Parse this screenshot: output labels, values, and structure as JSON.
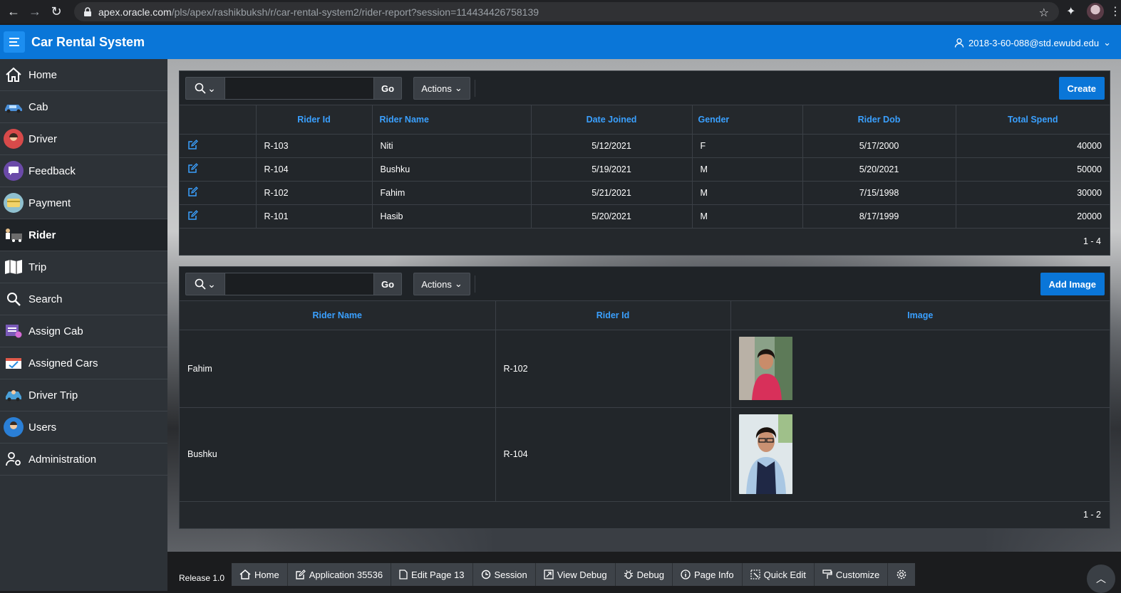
{
  "browser": {
    "url_host": "apex.oracle.com",
    "url_path": "/pls/apex/rashikbuksh/r/car-rental-system2/rider-report?session=114434426758139"
  },
  "header": {
    "title": "Car Rental System",
    "user": "2018-3-60-088@std.ewubd.edu"
  },
  "sidebar": {
    "items": [
      {
        "label": "Home",
        "icon": "home-icon"
      },
      {
        "label": "Cab",
        "icon": "cab-icon"
      },
      {
        "label": "Driver",
        "icon": "driver-icon"
      },
      {
        "label": "Feedback",
        "icon": "feedback-icon"
      },
      {
        "label": "Payment",
        "icon": "payment-icon"
      },
      {
        "label": "Rider",
        "icon": "rider-icon",
        "active": true
      },
      {
        "label": "Trip",
        "icon": "trip-icon"
      },
      {
        "label": "Search",
        "icon": "search-icon"
      },
      {
        "label": "Assign Cab",
        "icon": "assign-cab-icon"
      },
      {
        "label": "Assigned Cars",
        "icon": "assigned-cars-icon"
      },
      {
        "label": "Driver Trip",
        "icon": "driver-trip-icon"
      },
      {
        "label": "Users",
        "icon": "users-icon"
      },
      {
        "label": "Administration",
        "icon": "administration-icon"
      }
    ]
  },
  "riders_report": {
    "go_label": "Go",
    "actions_label": "Actions",
    "create_label": "Create",
    "columns": [
      "Rider Id",
      "Rider Name",
      "Date Joined",
      "Gender",
      "Rider Dob",
      "Total Spend"
    ],
    "rows": [
      {
        "rider_id": "R-103",
        "rider_name": "Niti",
        "date_joined": "5/12/2021",
        "gender": "F",
        "rider_dob": "5/17/2000",
        "total_spend": "40000"
      },
      {
        "rider_id": "R-104",
        "rider_name": "Bushku",
        "date_joined": "5/19/2021",
        "gender": "M",
        "rider_dob": "5/20/2021",
        "total_spend": "50000"
      },
      {
        "rider_id": "R-102",
        "rider_name": "Fahim",
        "date_joined": "5/21/2021",
        "gender": "M",
        "rider_dob": "7/15/1998",
        "total_spend": "30000"
      },
      {
        "rider_id": "R-101",
        "rider_name": "Hasib",
        "date_joined": "5/20/2021",
        "gender": "M",
        "rider_dob": "8/17/1999",
        "total_spend": "20000"
      }
    ],
    "pagination": "1 - 4"
  },
  "images_report": {
    "go_label": "Go",
    "actions_label": "Actions",
    "add_label": "Add Image",
    "columns": [
      "Rider Name",
      "Rider Id",
      "Image"
    ],
    "rows": [
      {
        "rider_name": "Fahim",
        "rider_id": "R-102"
      },
      {
        "rider_name": "Bushku",
        "rider_id": "R-104"
      }
    ],
    "pagination": "1 - 2"
  },
  "dev_toolbar": {
    "release": "Release 1.0",
    "items": [
      "Home",
      "Application 35536",
      "Edit Page 13",
      "Session",
      "View Debug",
      "Debug",
      "Page Info",
      "Quick Edit",
      "Customize"
    ]
  }
}
